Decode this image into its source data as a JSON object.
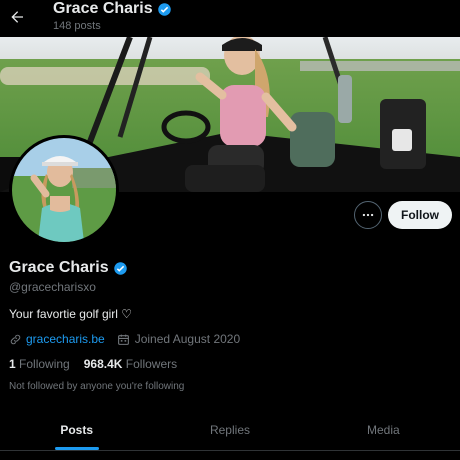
{
  "topbar": {
    "name": "Grace Charis",
    "posts_count": "148 posts",
    "back_icon": "arrow-left-icon"
  },
  "profile": {
    "display_name": "Grace Charis",
    "handle": "@gracecharisxo",
    "bio": "Your favortie golf girl ♡",
    "website": "gracecharis.be",
    "joined": "Joined August 2020",
    "following_count": "1",
    "following_label": "Following",
    "followers_count": "968.4K",
    "followers_label": "Followers",
    "not_followed_text": "Not followed by anyone you're following",
    "verified_color": "#1d9bf0"
  },
  "actions": {
    "follow_label": "Follow",
    "more_icon": "more-horizontal-icon"
  },
  "tabs": [
    {
      "label": "Posts",
      "active": true
    },
    {
      "label": "Replies",
      "active": false
    },
    {
      "label": "Media",
      "active": false
    }
  ],
  "colors": {
    "accent": "#1d9bf0",
    "background": "#000000",
    "muted": "#71767b"
  }
}
